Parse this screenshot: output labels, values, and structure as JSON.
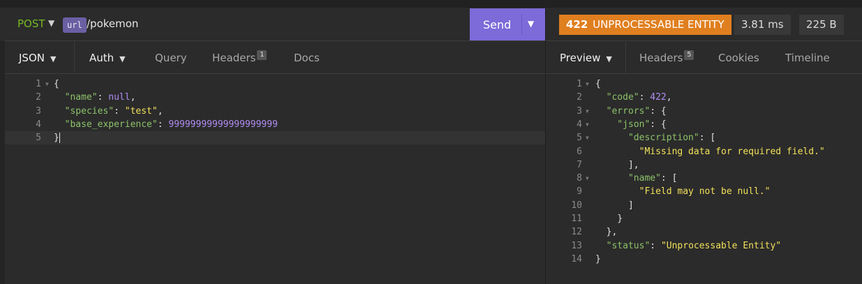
{
  "request": {
    "method": "POST",
    "url_tag": "url",
    "url_path": "/pokemon",
    "send_label": "Send",
    "tabs": {
      "body": "JSON",
      "auth": "Auth",
      "query": "Query",
      "headers": "Headers",
      "headers_count": "1",
      "docs": "Docs"
    },
    "lines": [
      {
        "n": "1",
        "t": [
          {
            "c": "p",
            "v": "{"
          }
        ]
      },
      {
        "n": "2",
        "t": [
          {
            "c": "k",
            "v": "  \"name\""
          },
          {
            "c": "p",
            "v": ": "
          },
          {
            "c": "n",
            "v": "null"
          },
          {
            "c": "p",
            "v": ","
          }
        ]
      },
      {
        "n": "3",
        "t": [
          {
            "c": "k",
            "v": "  \"species\""
          },
          {
            "c": "p",
            "v": ": "
          },
          {
            "c": "s",
            "v": "\"test\""
          },
          {
            "c": "p",
            "v": ","
          }
        ]
      },
      {
        "n": "4",
        "t": [
          {
            "c": "k",
            "v": "  \"base_experience\""
          },
          {
            "c": "p",
            "v": ": "
          },
          {
            "c": "n",
            "v": "99999999999999999999"
          }
        ]
      },
      {
        "n": "5",
        "t": [
          {
            "c": "p",
            "v": "}"
          }
        ]
      }
    ]
  },
  "response": {
    "status_code": "422",
    "status_text": "UNPROCESSABLE ENTITY",
    "time": "3.81 ms",
    "size": "225 B",
    "tabs": {
      "preview": "Preview",
      "headers": "Headers",
      "headers_count": "5",
      "cookies": "Cookies",
      "timeline": "Timeline"
    },
    "lines": [
      {
        "n": "1",
        "fold": true,
        "t": [
          {
            "c": "p",
            "v": "{"
          }
        ]
      },
      {
        "n": "2",
        "t": [
          {
            "c": "k",
            "v": "  \"code\""
          },
          {
            "c": "p",
            "v": ": "
          },
          {
            "c": "n",
            "v": "422"
          },
          {
            "c": "p",
            "v": ","
          }
        ]
      },
      {
        "n": "3",
        "fold": true,
        "t": [
          {
            "c": "k",
            "v": "  \"errors\""
          },
          {
            "c": "p",
            "v": ": {"
          }
        ]
      },
      {
        "n": "4",
        "fold": true,
        "t": [
          {
            "c": "k",
            "v": "    \"json\""
          },
          {
            "c": "p",
            "v": ": {"
          }
        ]
      },
      {
        "n": "5",
        "fold": true,
        "t": [
          {
            "c": "k",
            "v": "      \"description\""
          },
          {
            "c": "p",
            "v": ": ["
          }
        ]
      },
      {
        "n": "6",
        "t": [
          {
            "c": "s",
            "v": "        \"Missing data for required field.\""
          }
        ]
      },
      {
        "n": "7",
        "t": [
          {
            "c": "p",
            "v": "      ],"
          }
        ]
      },
      {
        "n": "8",
        "fold": true,
        "t": [
          {
            "c": "k",
            "v": "      \"name\""
          },
          {
            "c": "p",
            "v": ": ["
          }
        ]
      },
      {
        "n": "9",
        "t": [
          {
            "c": "s",
            "v": "        \"Field may not be null.\""
          }
        ]
      },
      {
        "n": "10",
        "t": [
          {
            "c": "p",
            "v": "      ]"
          }
        ]
      },
      {
        "n": "11",
        "t": [
          {
            "c": "p",
            "v": "    }"
          }
        ]
      },
      {
        "n": "12",
        "t": [
          {
            "c": "p",
            "v": "  },"
          }
        ]
      },
      {
        "n": "13",
        "t": [
          {
            "c": "k",
            "v": "  \"status\""
          },
          {
            "c": "p",
            "v": ": "
          },
          {
            "c": "s",
            "v": "\"Unprocessable Entity\""
          }
        ]
      },
      {
        "n": "14",
        "t": [
          {
            "c": "p",
            "v": "}"
          }
        ]
      }
    ]
  },
  "colors": {
    "send_button": "#7c6bd8",
    "status_badge": "#e07f1f",
    "method": "#75ba24",
    "json_key": "#8cc26a",
    "json_string": "#f1e05a",
    "json_number": "#b18cf2"
  },
  "icons": [
    "chevron-down-icon",
    "fold-arrow-icon"
  ]
}
